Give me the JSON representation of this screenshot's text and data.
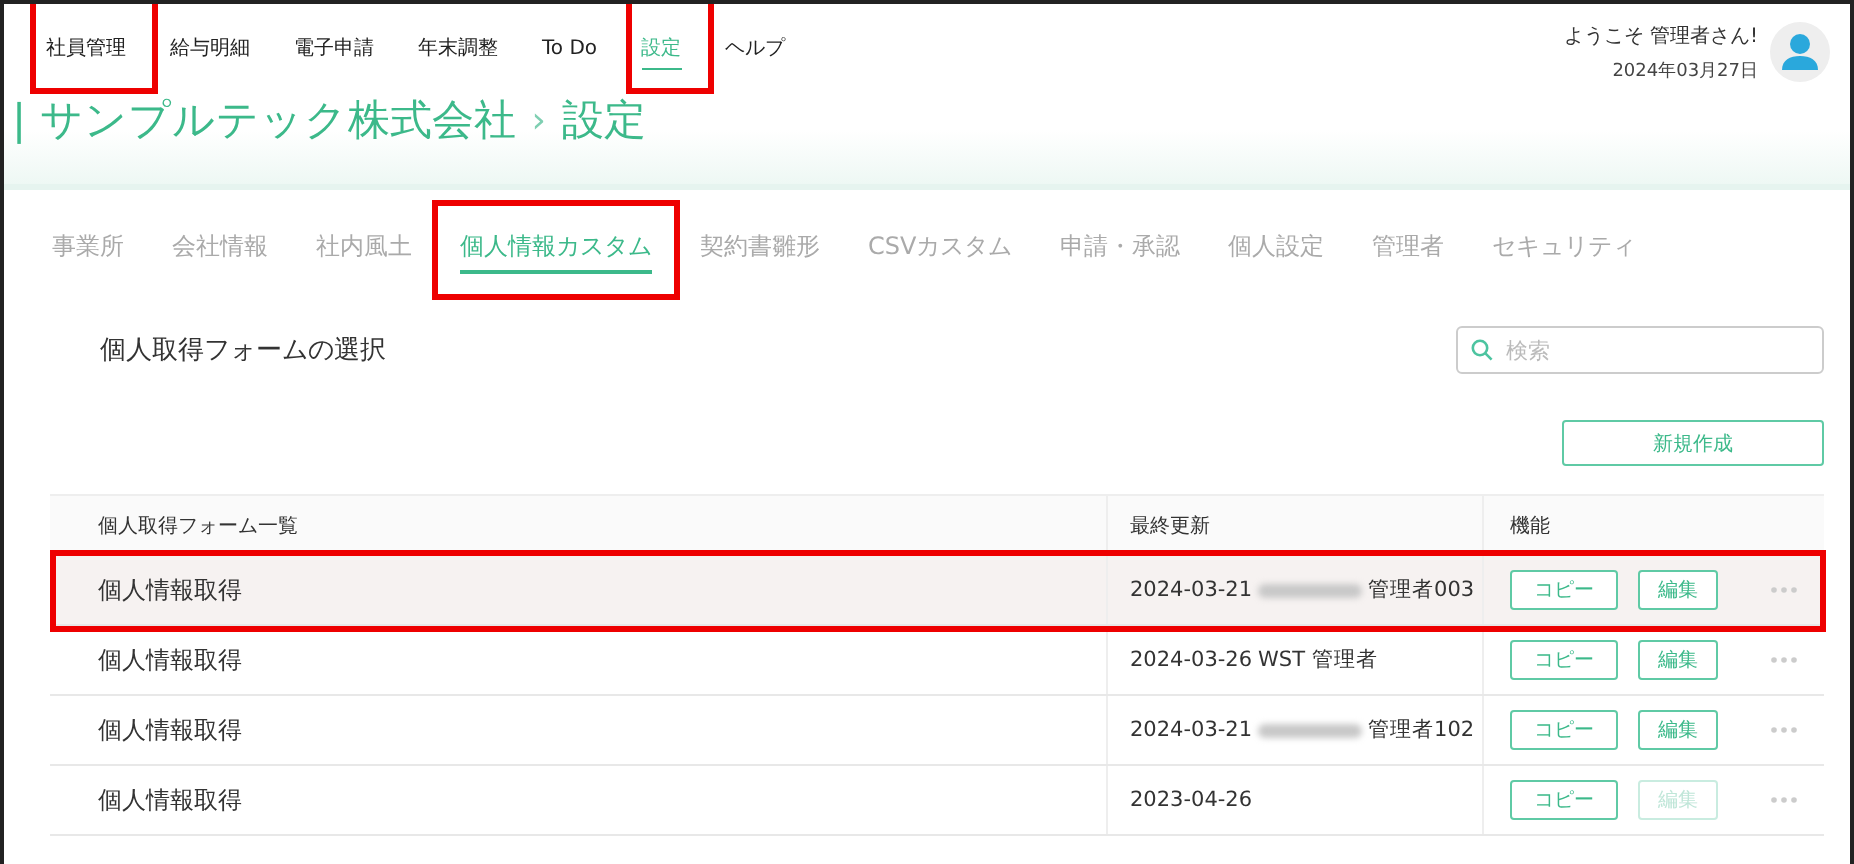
{
  "nav": {
    "items": [
      {
        "label": "社員管理",
        "selected": false,
        "highlighted": true
      },
      {
        "label": "給与明細",
        "selected": false,
        "highlighted": false
      },
      {
        "label": "電子申請",
        "selected": false,
        "highlighted": false
      },
      {
        "label": "年末調整",
        "selected": false,
        "highlighted": false
      },
      {
        "label": "To Do",
        "selected": false,
        "highlighted": false
      },
      {
        "label": "設定",
        "selected": true,
        "highlighted": true
      },
      {
        "label": "ヘルプ",
        "selected": false,
        "highlighted": false
      }
    ]
  },
  "user": {
    "greeting": "ようこそ 管理者さん!",
    "date": "2024年03月27日"
  },
  "breadcrumb": {
    "company": "| サンプルテック株式会社",
    "separator": "›",
    "page": "設定"
  },
  "tabs": [
    {
      "label": "事業所",
      "selected": false,
      "highlighted": false
    },
    {
      "label": "会社情報",
      "selected": false,
      "highlighted": false
    },
    {
      "label": "社内風土",
      "selected": false,
      "highlighted": false
    },
    {
      "label": "個人情報カスタム",
      "selected": true,
      "highlighted": true
    },
    {
      "label": "契約書雛形",
      "selected": false,
      "highlighted": false
    },
    {
      "label": "CSVカスタム",
      "selected": false,
      "highlighted": false
    },
    {
      "label": "申請・承認",
      "selected": false,
      "highlighted": false
    },
    {
      "label": "個人設定",
      "selected": false,
      "highlighted": false
    },
    {
      "label": "管理者",
      "selected": false,
      "highlighted": false
    },
    {
      "label": "セキュリティ",
      "selected": false,
      "highlighted": false
    }
  ],
  "section": {
    "title": "個人取得フォームの選択",
    "search": {
      "placeholder": "検索"
    },
    "new_button": "新規作成"
  },
  "table": {
    "columns": [
      "個人取得フォーム一覧",
      "最終更新",
      "機能"
    ],
    "rows": [
      {
        "name": "個人情報取得",
        "date": "2024-03-21",
        "redacted": true,
        "user": "管理者003",
        "copy": "コピー",
        "edit": "編集",
        "edit_disabled": false,
        "highlighted": true
      },
      {
        "name": "個人情報取得",
        "date": "2024-03-26",
        "redacted": false,
        "user": "WST 管理者",
        "copy": "コピー",
        "edit": "編集",
        "edit_disabled": false,
        "highlighted": false
      },
      {
        "name": "個人情報取得",
        "date": "2024-03-21",
        "redacted": true,
        "user": "管理者102",
        "copy": "コピー",
        "edit": "編集",
        "edit_disabled": false,
        "highlighted": false
      },
      {
        "name": "個人情報取得",
        "date": "2023-04-26",
        "redacted": false,
        "user": "",
        "copy": "コピー",
        "edit": "編集",
        "edit_disabled": true,
        "highlighted": false
      }
    ]
  }
}
